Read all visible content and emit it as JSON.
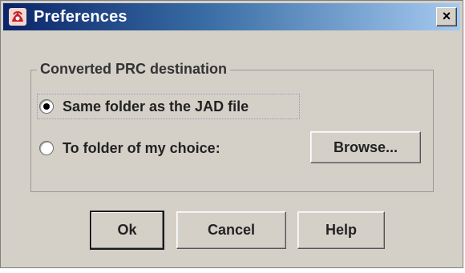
{
  "window": {
    "title": "Preferences",
    "close_glyph": "×",
    "icon": "java-app-icon"
  },
  "destination_group": {
    "title": "Converted PRC destination",
    "options": [
      {
        "label": "Same folder as the JAD file",
        "selected": true
      },
      {
        "label": "To folder of my choice:",
        "selected": false
      }
    ],
    "browse_label": "Browse..."
  },
  "buttons": {
    "ok_label": "Ok",
    "cancel_label": "Cancel",
    "help_label": "Help"
  }
}
